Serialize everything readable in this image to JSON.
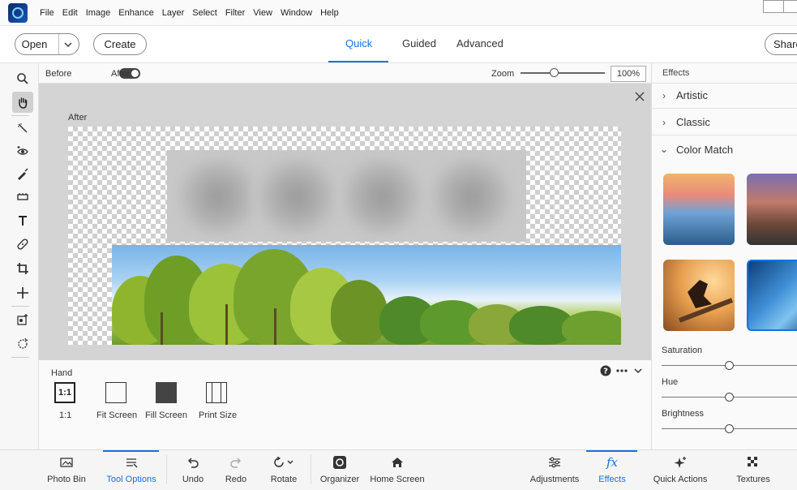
{
  "menu": [
    "File",
    "Edit",
    "Image",
    "Enhance",
    "Layer",
    "Select",
    "Filter",
    "View",
    "Window",
    "Help"
  ],
  "topbar": {
    "open_label": "Open",
    "create_label": "Create",
    "share_label": "Share",
    "modes": [
      "Quick",
      "Guided",
      "Advanced"
    ]
  },
  "view": {
    "before_label": "Before",
    "after_label": "After",
    "zoom_label": "Zoom",
    "zoom_value": "100%",
    "canvas_label": "After"
  },
  "tool_options": {
    "tool_name": "Hand",
    "one_to_one_glyph": "1:1",
    "buttons": [
      "1:1",
      "Fit Screen",
      "Fill Screen",
      "Print Size"
    ]
  },
  "effects_panel": {
    "title": "Effects",
    "sections": [
      "Artistic",
      "Classic",
      "Color Match"
    ],
    "sliders": [
      "Saturation",
      "Hue",
      "Brightness"
    ],
    "slider_values": [
      0.5,
      0.5,
      0.5
    ]
  },
  "bottombar": {
    "items": [
      "Photo Bin",
      "Tool Options",
      "Undo",
      "Redo",
      "Rotate",
      "Organizer",
      "Home Screen",
      "Adjustments",
      "Effects",
      "Quick Actions",
      "Textures"
    ]
  },
  "colors": {
    "accent": "#1473e6"
  }
}
